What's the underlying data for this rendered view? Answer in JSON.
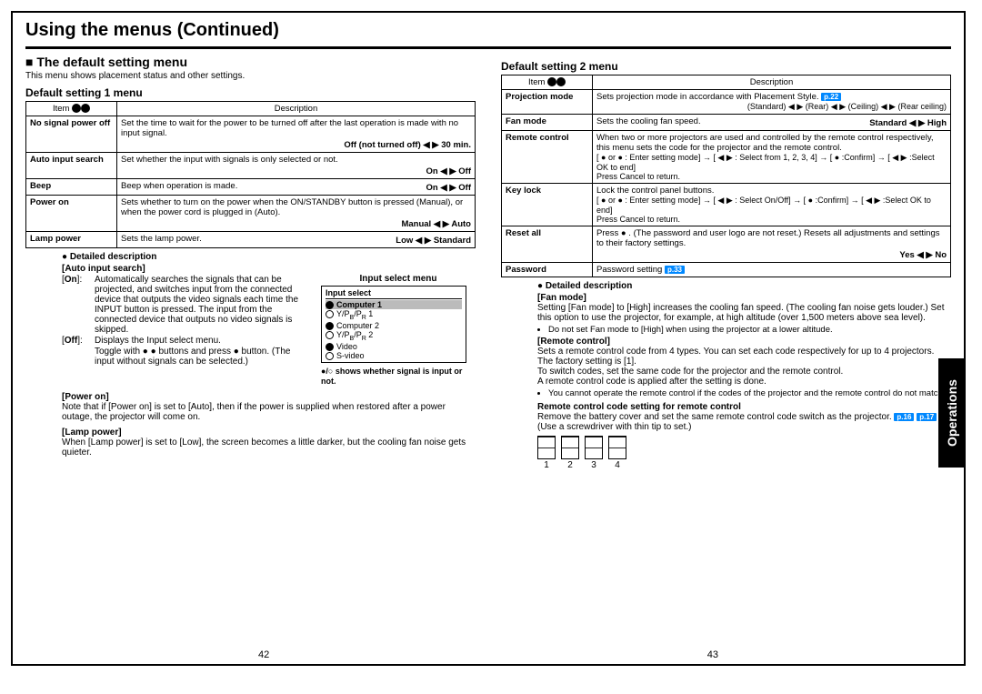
{
  "title": "Using the menus (Continued)",
  "sideTab": "Operations",
  "leftPage": "42",
  "rightPage": "43",
  "left": {
    "heading": "■ The default setting menu",
    "intro": "This menu shows placement status and other settings.",
    "table1Title": "Default setting 1 menu",
    "header": {
      "item": "Item",
      "desc": "Description"
    },
    "rows": [
      {
        "item": "No signal power off",
        "desc": "Set the time to wait for the power to be turned off after the last operation is made with no input signal.",
        "opt": "Off (not turned off) ◀ ▶ 30 min."
      },
      {
        "item": "Auto input search",
        "desc": "Set whether the input with signals is only selected or not.",
        "opt": "On ◀ ▶ Off"
      },
      {
        "item": "Beep",
        "desc": "Beep when operation is made.",
        "opt": "On ◀ ▶ Off"
      },
      {
        "item": "Power on",
        "desc": "Sets whether to turn on the power when the ON/STANDBY button is pressed (Manual), or when the power cord is plugged in (Auto).",
        "opt": "Manual ◀ ▶ Auto"
      },
      {
        "item": "Lamp power",
        "desc": "Sets the lamp power.",
        "opt": "Low ◀ ▶ Standard"
      }
    ],
    "detailed": {
      "title": "● Detailed description",
      "autoInput": {
        "label": "[Auto input search]",
        "on": "Automatically searches the signals that can be projected, and switches input from the connected device that outputs the video signals each time the INPUT button is pressed. The input from the connected device that outputs no video signals is skipped.",
        "off": "Displays the Input select menu.",
        "toggle": "Toggle with ● ● buttons and press ● button. (The input without signals can be selected.)"
      },
      "inputSelect": {
        "title": "Input select menu",
        "boxHeader": "Input select",
        "items": [
          "Computer 1",
          "Y/PB/PR 1",
          "Computer 2",
          "Y/PB/PR 2",
          "Video",
          "S-video"
        ],
        "note": "●/○ shows whether signal is input or not."
      },
      "powerOn": {
        "label": "[Power on]",
        "text": "Note that if [Power on] is set to [Auto], then if the power is supplied when restored after a power outage, the projector will come on."
      },
      "lampPower": {
        "label": "[Lamp power]",
        "text": "When [Lamp power] is set to [Low], the screen becomes a little darker, but the cooling fan noise gets quieter."
      }
    }
  },
  "right": {
    "table2Title": "Default setting 2 menu",
    "header": {
      "item": "Item",
      "desc": "Description"
    },
    "rows": [
      {
        "item": "Projection mode",
        "desc": "Sets projection mode in accordance with Placement Style.",
        "pref": "p.22",
        "opt": "(Standard) ◀ ▶ (Rear) ◀ ▶ (Ceiling) ◀ ▶ (Rear ceiling)"
      },
      {
        "item": "Fan mode",
        "desc": "Sets the cooling fan speed.",
        "opt": "Standard ◀ ▶ High"
      },
      {
        "item": "Remote control",
        "desc": "When two or more projectors are used and controlled by the remote control respectively, this menu sets the code for the projector and the remote control.",
        "flow": "[ ● or ● : Enter setting mode] → [ ◀ ▶ : Select from 1, 2, 3, 4] → [ ● :Confirm] → [ ◀ ▶ :Select OK to end]",
        "cancel": "Press Cancel to return."
      },
      {
        "item": "Key lock",
        "desc": "Lock the control panel buttons.",
        "flow": "[ ● or ● : Enter setting mode] → [ ◀ ▶ : Select On/Off] → [ ● :Confirm] → [ ◀ ▶ :Select OK to end]",
        "cancel": "Press Cancel to return."
      },
      {
        "item": "Reset all",
        "desc": "Press ● . (The password and user logo are not reset.) Resets all adjustments and settings to their factory settings.",
        "opt": "Yes ◀ ▶ No"
      },
      {
        "item": "Password",
        "desc": "Password setting",
        "pref": "p.33"
      }
    ],
    "detailed": {
      "title": "● Detailed description",
      "fanMode": {
        "label": "[Fan mode]",
        "text": "Setting [Fan mode] to [High] increases the cooling fan speed. (The cooling fan noise gets louder.) Set this option to use the projector, for example, at high altitude (over 1,500 meters above sea level).",
        "bullet": "Do not set Fan mode to [High] when using the projector at a lower altitude."
      },
      "remote": {
        "label": "[Remote control]",
        "text1": "Sets a remote control code from 4 types. You can set each code respectively for up to 4 projectors. The factory setting is [1].",
        "text2": "To switch codes, set the same code for the projector and the remote control.",
        "text3": "A remote control code is applied after the setting is done.",
        "bullet": "You cannot operate the remote control if the codes of the projector and the remote control do not match."
      },
      "codeSetting": {
        "label": "Remote control code setting for remote control",
        "text": "Remove the battery cover and set the same remote control code switch as the projector.",
        "pref1": "p.16",
        "pref2": "p.17",
        "tail": "(Use a screwdriver with thin tip to set.)"
      },
      "dipLabels": [
        "1",
        "2",
        "3",
        "4"
      ]
    }
  }
}
